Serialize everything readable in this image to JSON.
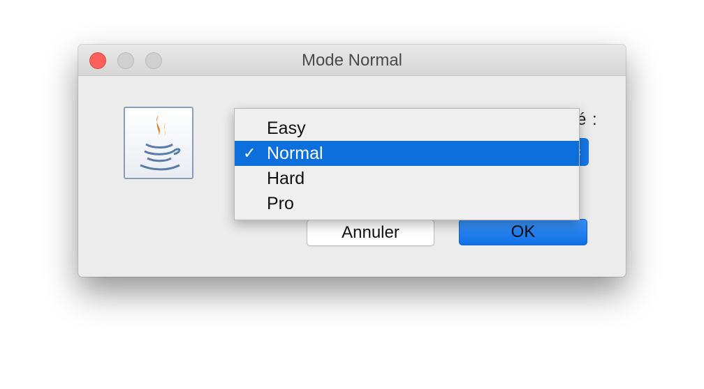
{
  "window": {
    "title": "Mode Normal"
  },
  "dialog": {
    "label_partial": "é :",
    "icon": "java-coffee-icon"
  },
  "buttons": {
    "cancel_label": "Annuler",
    "ok_label": "OK"
  },
  "dropdown": {
    "selected_value": "Normal",
    "items": [
      {
        "label": "Easy",
        "check": ""
      },
      {
        "label": "Normal",
        "check": "✓"
      },
      {
        "label": "Hard",
        "check": ""
      },
      {
        "label": "Pro",
        "check": ""
      }
    ]
  },
  "colors": {
    "accent": "#0c6fdb",
    "close": "#fc605b",
    "java_orange": "#e8761c",
    "java_blue": "#5a7ca8"
  }
}
